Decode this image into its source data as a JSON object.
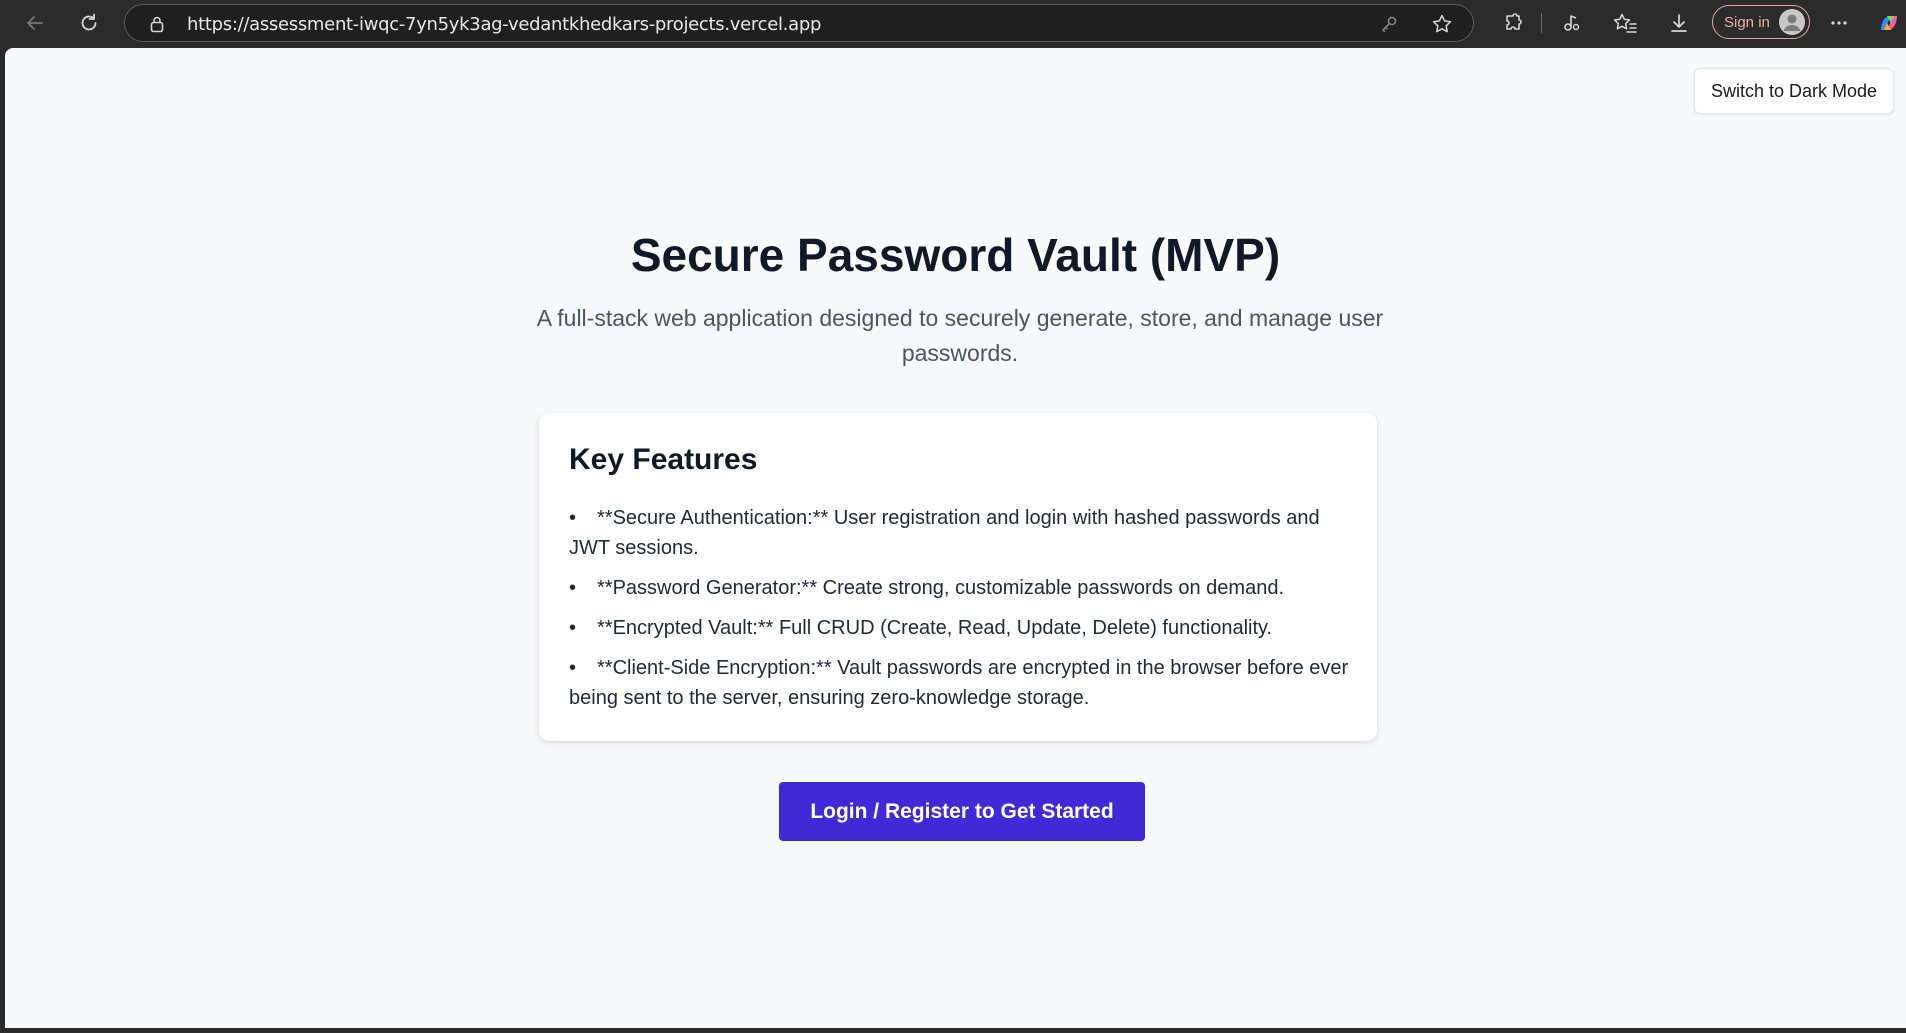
{
  "browser": {
    "url": "https://assessment-iwqc-7yn5yk3ag-vedantkhedkars-projects.vercel.app",
    "sign_in_label": "Sign in",
    "icons": [
      "back-icon",
      "refresh-icon",
      "lock-icon",
      "key-icon",
      "star-icon",
      "extensions-icon",
      "media-icon",
      "favorites-icon",
      "download-icon",
      "avatar",
      "more-icon",
      "copilot-icon"
    ]
  },
  "page": {
    "dark_mode_label": "Switch to Dark Mode",
    "title": "Secure Password Vault (MVP)",
    "subtitle": "A full-stack web application designed to securely generate, store, and manage user passwords.",
    "features_heading": "Key Features",
    "features": [
      {
        "text": "**Secure Authentication:** User registration and login with hashed passwords and JWT sessions."
      },
      {
        "text": "**Password Generator:** Create strong, customizable passwords on demand."
      },
      {
        "text": "**Encrypted Vault:** Full CRUD (Create, Read, Update, Delete) functionality."
      },
      {
        "text": "**Client-Side Encryption:** Vault passwords are encrypted in the browser before ever being sent to the server, ensuring zero-knowledge storage."
      }
    ],
    "cta_label": "Login / Register to Get Started"
  },
  "colors": {
    "accent": "#4229d8",
    "page_bg": "#f8f9fa",
    "title_text": "#111827",
    "browser_chrome": "#2b2b2b"
  }
}
